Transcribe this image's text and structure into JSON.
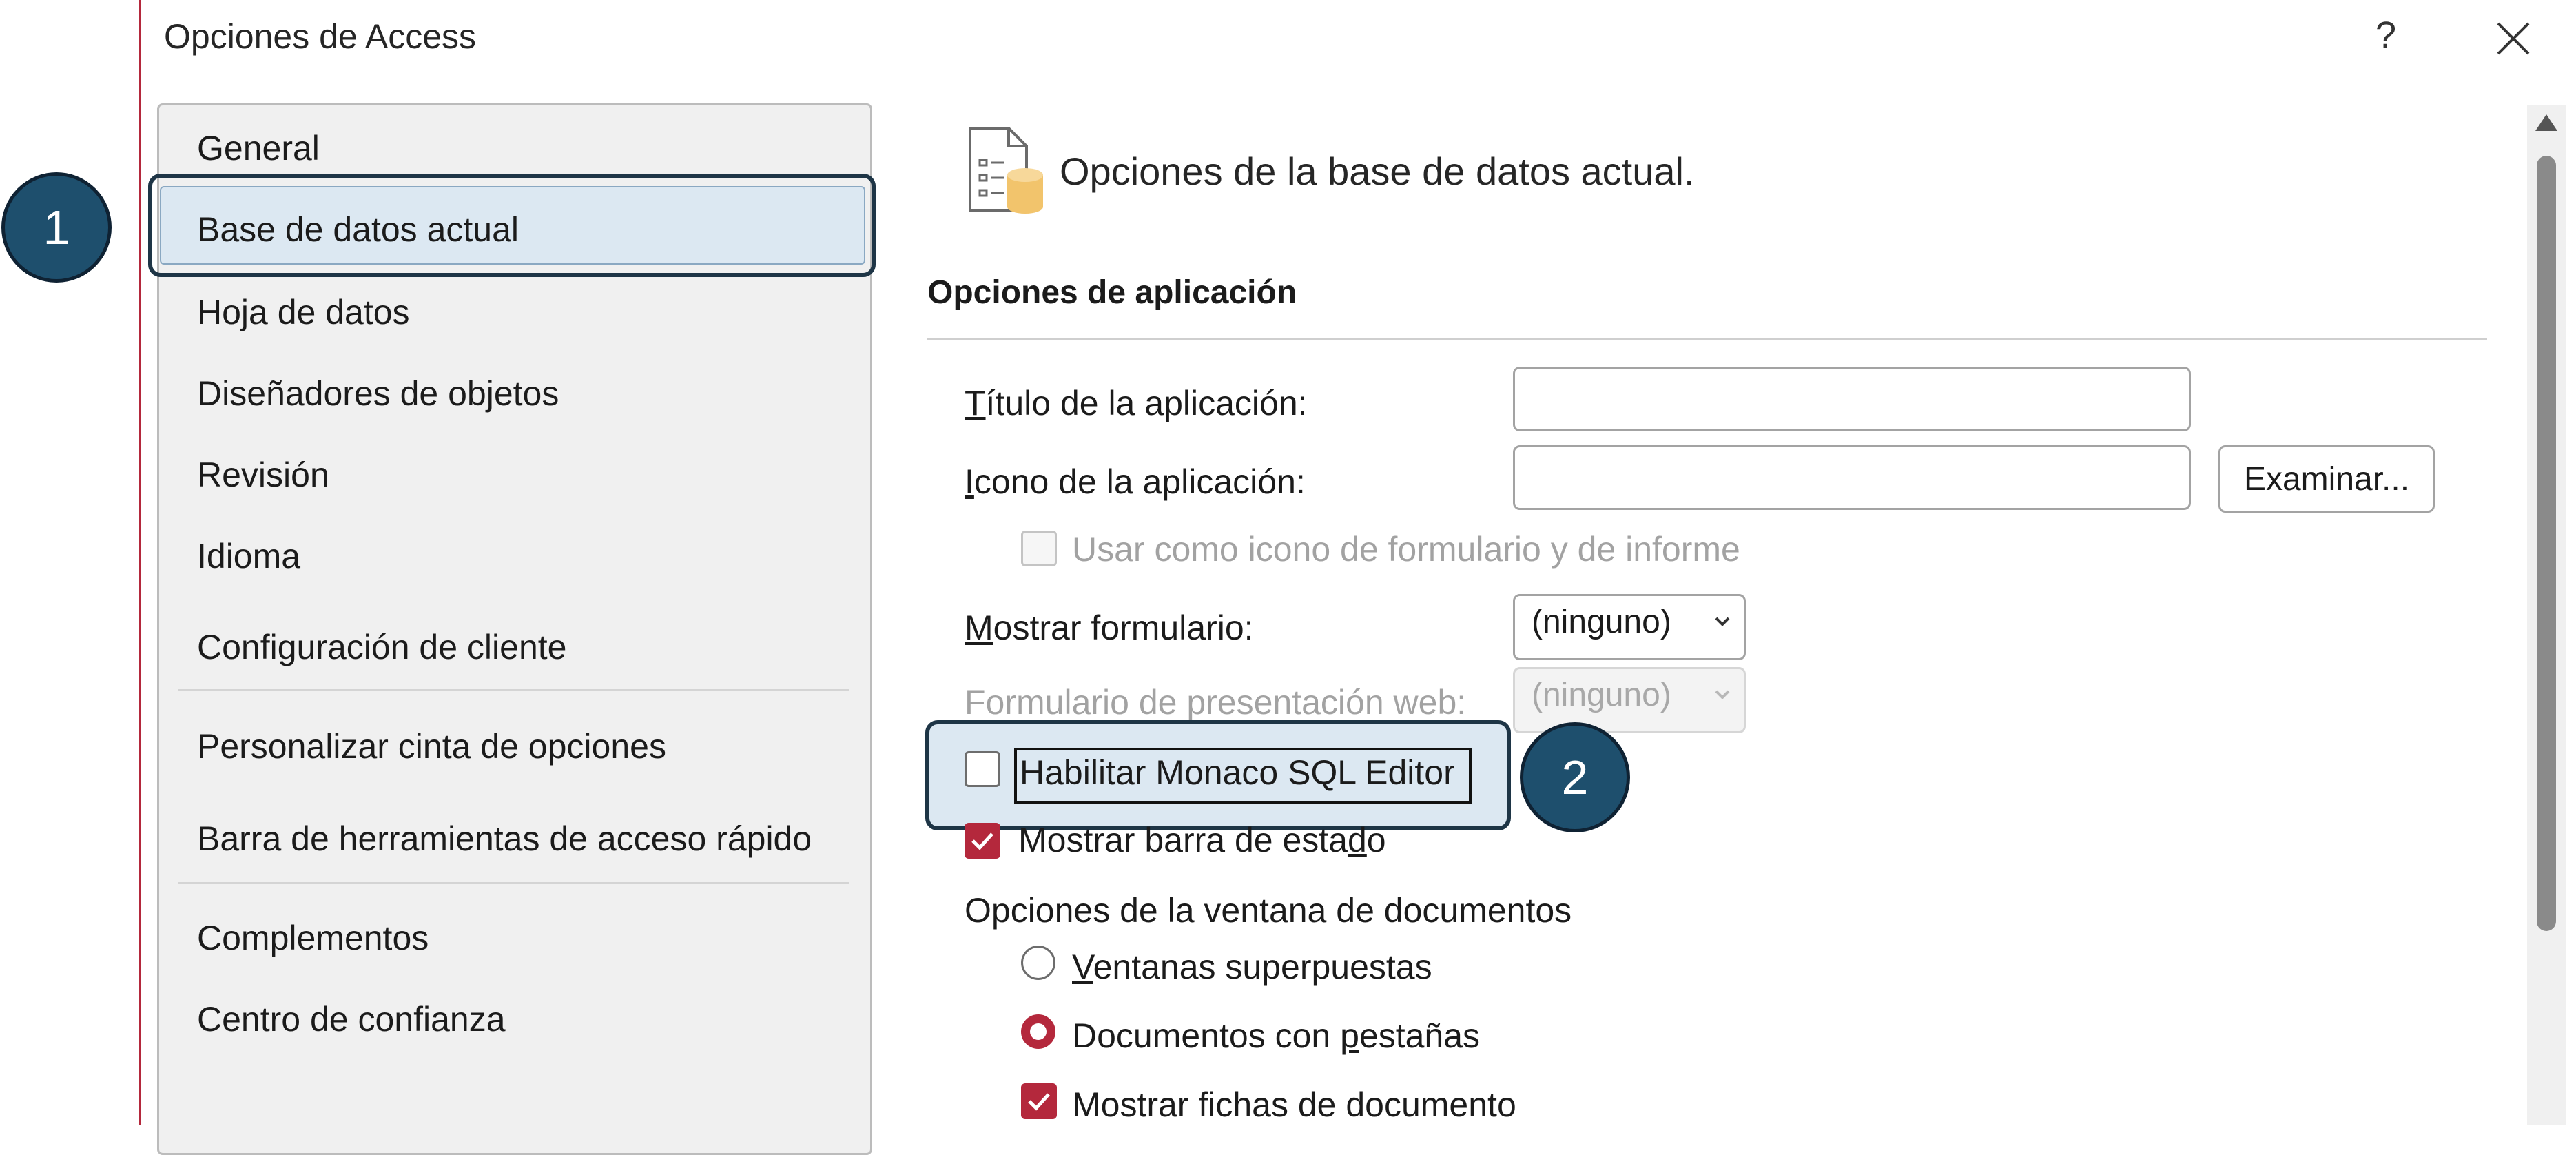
{
  "window": {
    "title": "Opciones de Access",
    "help_label": "?",
    "close_label": "✕"
  },
  "nav": {
    "items": [
      {
        "label": "General"
      },
      {
        "label": "Base de datos actual",
        "selected": true
      },
      {
        "label": "Hoja de datos"
      },
      {
        "label": "Diseñadores de objetos"
      },
      {
        "label": "Revisión"
      },
      {
        "label": "Idioma"
      },
      {
        "label": "Configuración de cliente"
      },
      {
        "label": "Personalizar cinta de opciones"
      },
      {
        "label": "Barra de herramientas de acceso rápido"
      },
      {
        "label": "Complementos"
      },
      {
        "label": "Centro de confianza"
      }
    ]
  },
  "callouts": {
    "one": "1",
    "two": "2"
  },
  "header": {
    "title": "Opciones de la base de datos actual.",
    "icon": "database-options-icon"
  },
  "section": {
    "title": "Opciones de aplicación"
  },
  "fields": {
    "app_title": {
      "underline": "T",
      "rest": "ítulo de la aplicación:",
      "value": ""
    },
    "app_icon": {
      "underline": "I",
      "rest": "cono de la aplicación:",
      "value": ""
    },
    "browse_button": "Examinar...",
    "use_as_form_icon": {
      "label": "Usar como icono de formulario y de informe",
      "checked": false,
      "disabled": true
    },
    "display_form": {
      "underline": "M",
      "rest": "ostrar formulario:",
      "value": "(ninguno)"
    },
    "web_display_form": {
      "pre": "Formulario de presentación web:",
      "value": "(ninguno)",
      "disabled": true
    },
    "monaco": {
      "label": "Habilitar Monaco SQL Editor",
      "checked": false
    },
    "status_bar": {
      "pre": "Mostrar barra de esta",
      "underline": "d",
      "post": "o",
      "checked": true
    }
  },
  "document_window": {
    "heading": "Opciones de la ventana de documentos",
    "overlapping": {
      "underline": "V",
      "rest": "entanas superpuestas",
      "selected": false
    },
    "tabbed": {
      "pre": "Documentos con ",
      "underline": "p",
      "post": "estañas",
      "selected": true
    },
    "show_tabs": {
      "label": "Mostrar fichas de documento",
      "checked": true
    }
  },
  "colors": {
    "accent": "#b4283c",
    "callout": "#1e4f6d",
    "selection": "#dce8f2"
  }
}
